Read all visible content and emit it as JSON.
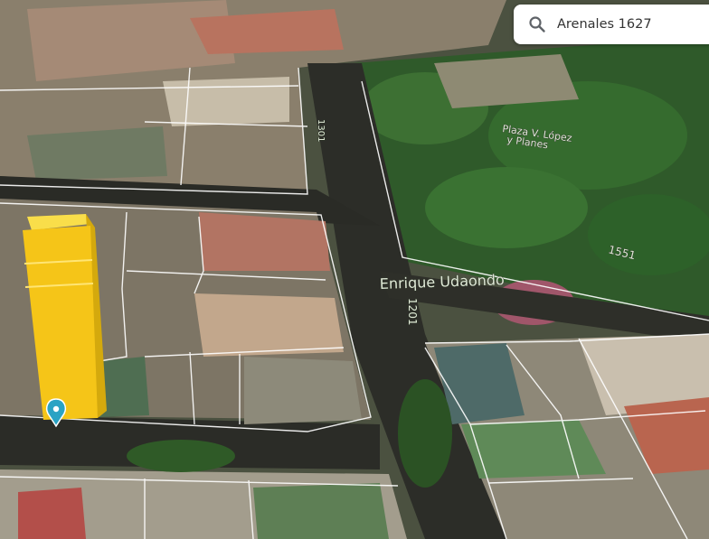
{
  "search": {
    "value": "Arenales 1627",
    "icon": "search-icon"
  },
  "map": {
    "streets": [
      {
        "name": "Enrique Udaondo"
      },
      {
        "name": "Plaza V. López y Planes"
      },
      {
        "name": "1551"
      },
      {
        "name": "1201"
      },
      {
        "name": "1301"
      }
    ],
    "building_color": "#f5c518",
    "marker_color": "#2aa3c4",
    "parcel_line_color": "#ffffff"
  }
}
